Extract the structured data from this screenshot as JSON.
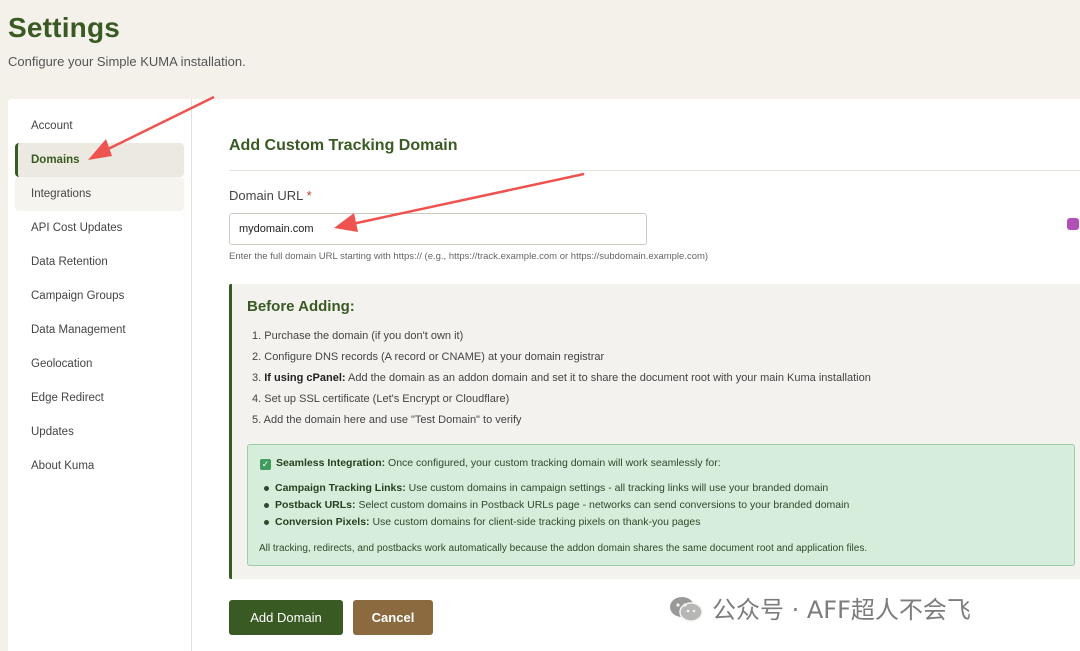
{
  "header": {
    "title": "Settings",
    "subtitle": "Configure your Simple KUMA installation."
  },
  "sidebar": {
    "items": [
      {
        "label": "Account"
      },
      {
        "label": "Domains"
      },
      {
        "label": "Integrations"
      },
      {
        "label": "API Cost Updates"
      },
      {
        "label": "Data Retention"
      },
      {
        "label": "Campaign Groups"
      },
      {
        "label": "Data Management"
      },
      {
        "label": "Geolocation"
      },
      {
        "label": "Edge Redirect"
      },
      {
        "label": "Updates"
      },
      {
        "label": "About Kuma"
      }
    ],
    "active_index": 1
  },
  "main": {
    "section_title": "Add Custom Tracking Domain",
    "field_label": "Domain URL",
    "required_mark": "*",
    "input_value": "mydomain.com",
    "help_text": "Enter the full domain URL starting with https:// (e.g., https://track.example.com or https://subdomain.example.com)",
    "info": {
      "title": "Before Adding:",
      "steps": [
        {
          "num": "1.",
          "bold": "",
          "text": "Purchase the domain (if you don't own it)"
        },
        {
          "num": "2.",
          "bold": "",
          "text": "Configure DNS records (A record or CNAME) at your domain registrar"
        },
        {
          "num": "3.",
          "bold": "If using cPanel:",
          "text": "Add the domain as an addon domain and set it to share the document root with your main Kuma installation"
        },
        {
          "num": "4.",
          "bold": "",
          "text": "Set up SSL certificate (Let's Encrypt or Cloudflare)"
        },
        {
          "num": "5.",
          "bold": "",
          "text": "Add the domain here and use \"Test Domain\" to verify"
        }
      ]
    },
    "success": {
      "head_bold": "Seamless Integration:",
      "head_text": "Once configured, your custom tracking domain will work seamlessly for:",
      "bullets": [
        {
          "bold": "Campaign Tracking Links:",
          "text": "Use custom domains in campaign settings - all tracking links will use your branded domain"
        },
        {
          "bold": "Postback URLs:",
          "text": "Select custom domains in Postback URLs page - networks can send conversions to your branded domain"
        },
        {
          "bold": "Conversion Pixels:",
          "text": "Use custom domains for client-side tracking pixels on thank-you pages"
        }
      ],
      "footer": "All tracking, redirects, and postbacks work automatically because the addon domain shares the same document root and application files."
    },
    "buttons": {
      "add": "Add Domain",
      "cancel": "Cancel"
    }
  },
  "watermark": {
    "text": "公众号 · AFF超人不会飞"
  },
  "colors": {
    "brand_green": "#3a5a24",
    "cancel_brown": "#8b6a3f",
    "arrow_red": "#ef5350",
    "success_bg": "#d6eddb"
  }
}
